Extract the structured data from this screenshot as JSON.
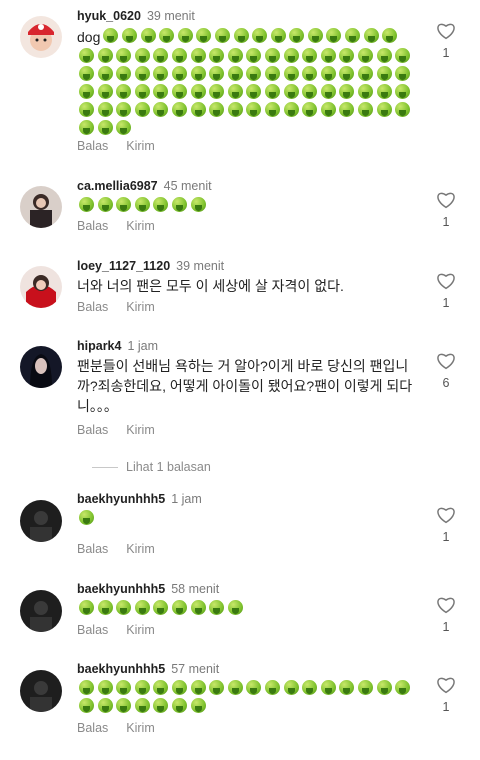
{
  "comments": [
    {
      "username": "hyuk_0620",
      "time": "39 menit",
      "text": "dog",
      "emoji_count": 91,
      "reply": "Balas",
      "send": "Kirim",
      "likes": "1"
    },
    {
      "username": "ca.mellia6987",
      "time": "45 menit",
      "text": "",
      "emoji_count": 7,
      "reply": "Balas",
      "send": "Kirim",
      "likes": "1"
    },
    {
      "username": "loey_1127_1120",
      "time": "39 menit",
      "text": "너와 너의 팬은 모두 이 세상에 살 자격이 없다.",
      "emoji_count": 0,
      "reply": "Balas",
      "send": "Kirim",
      "likes": "1"
    },
    {
      "username": "hipark4",
      "time": "1 jam",
      "text": "팬분들이 선배님 욕하는 거 알아?이게 바로 당신의 팬입니까?죄송한데요, 어떻게 아이돌이 됐어요?팬이 이렇게 되다니。。。",
      "emoji_count": 0,
      "reply": "Balas",
      "send": "Kirim",
      "likes": "6"
    },
    {
      "username": "baekhyunhhh5",
      "time": "1 jam",
      "text": "",
      "emoji_count": 1,
      "reply": "Balas",
      "send": "Kirim",
      "likes": "1"
    },
    {
      "username": "baekhyunhhh5",
      "time": "58 menit",
      "text": "",
      "emoji_count": 9,
      "reply": "Balas",
      "send": "Kirim",
      "likes": "1"
    },
    {
      "username": "baekhyunhhh5",
      "time": "57 menit",
      "text": "",
      "emoji_count": 25,
      "reply": "Balas",
      "send": "Kirim",
      "likes": "1"
    }
  ],
  "view_replies": "Lihat 1 balasan",
  "icons": {
    "emoji": "nauseated-face-emoji",
    "like": "heart-outline-icon"
  }
}
